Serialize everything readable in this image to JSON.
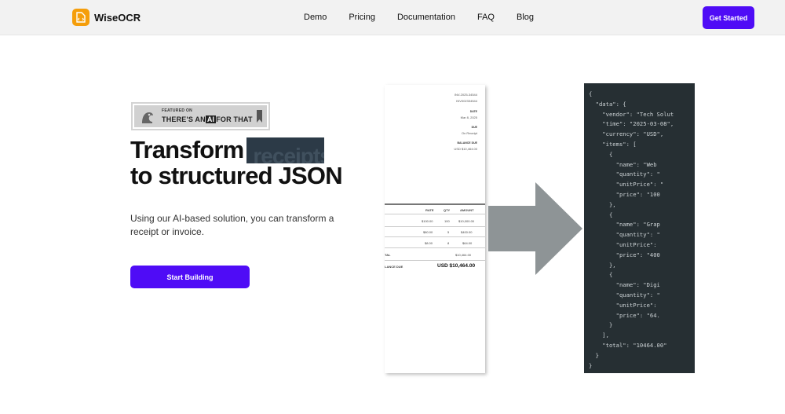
{
  "brand": {
    "name": "WiseOCR",
    "accent": "#4f0cf6",
    "logo_color": "#f59e0b"
  },
  "nav": {
    "links": [
      "Demo",
      "Pricing",
      "Documentation",
      "FAQ",
      "Blog"
    ],
    "cta": "Get Started"
  },
  "badge": {
    "small": "FEATURED ON",
    "big_prefix": "THERE'S AN",
    "big_ai": "AI",
    "big_suffix": "FOR THAT"
  },
  "hero": {
    "title_line1": "Transform",
    "title_highlight": "receipts",
    "title_line2": "to structured JSON",
    "subtitle": "Using our AI-based solution, you can transform a receipt or invoice.",
    "cta": "Start Building"
  },
  "receipt": {
    "meta": [
      "INV-2025-34544",
      "INV002334544"
    ],
    "date_label": "DATE",
    "date_value": "Mar 8, 2025",
    "due_label": "DUE",
    "due_value": "On Receipt",
    "balance_label": "BALANCE DUE",
    "balance_value": "USD $10,464.00",
    "columns": [
      "RATE",
      "QTY",
      "AMOUNT"
    ],
    "rows": [
      [
        "$100.00",
        "100",
        "$10,000.00"
      ],
      [
        "$80.00",
        "5",
        "$400.00"
      ],
      [
        "$8.00",
        "8",
        "$64.00"
      ]
    ],
    "total_label": "TAL",
    "total_value": "$10,464.00",
    "balance_row_label": "LANCE DUE",
    "balance_row_value": "USD $10,464.00"
  },
  "json_preview": [
    "{",
    "  \"data\": {",
    "    \"vendor\": \"Tech Solut",
    "    \"time\": \"2025-03-08\",",
    "    \"currency\": \"USD\",",
    "    \"items\": [",
    "      {",
    "        \"name\": \"Web",
    "        \"quantity\": \"",
    "        \"unitPrice\": \"",
    "        \"price\": \"100",
    "      },",
    "      {",
    "        \"name\": \"Grap",
    "        \"quantity\": \"",
    "        \"unitPrice\":",
    "        \"price\": \"400",
    "      },",
    "      {",
    "        \"name\": \"Digi",
    "        \"quantity\": \"",
    "        \"unitPrice\":",
    "        \"price\": \"64.",
    "      }",
    "    ],",
    "    \"total\": \"10464.00\"",
    "  }",
    "}"
  ]
}
